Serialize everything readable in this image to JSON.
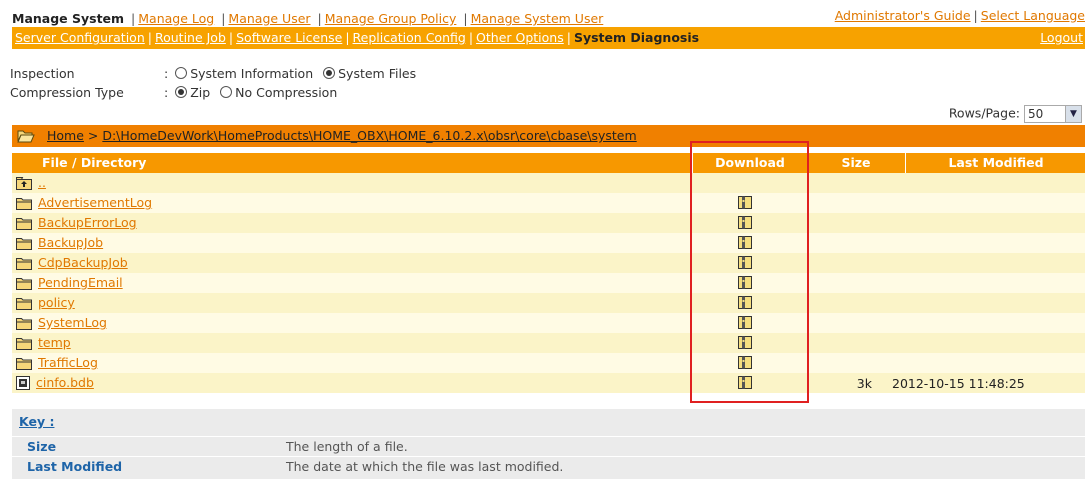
{
  "nav": {
    "title": "Manage System",
    "links": [
      "Manage Log",
      "Manage User",
      "Manage Group Policy",
      "Manage System User"
    ],
    "guide": "Administrator's Guide",
    "language": "Select Language"
  },
  "subnav": {
    "links": [
      "Server Configuration",
      "Routine Job",
      "Software License",
      "Replication Config",
      "Other Options"
    ],
    "active": "System Diagnosis",
    "logout": "Logout"
  },
  "options": {
    "inspection_label": "Inspection",
    "inspection_choices": [
      "System Information",
      "System Files"
    ],
    "inspection_selected": "System Files",
    "compression_label": "Compression Type",
    "compression_choices": [
      "Zip",
      "No Compression"
    ],
    "compression_selected": "Zip"
  },
  "rows_per_page": {
    "label": "Rows/Page:",
    "value": "50"
  },
  "path": {
    "home": "Home",
    "separator": " > ",
    "current": "D:\\HomeDevWork\\HomeProducts\\HOME_OBX\\HOME_6.10.2.x\\obsr\\core\\cbase\\system"
  },
  "table": {
    "headers": [
      "File / Directory",
      "Download",
      "Size",
      "Last Modified"
    ],
    "parent": "..",
    "rows": [
      {
        "name": "AdvertisementLog",
        "type": "folder",
        "size": "",
        "modified": ""
      },
      {
        "name": "BackupErrorLog",
        "type": "folder",
        "size": "",
        "modified": ""
      },
      {
        "name": "BackupJob",
        "type": "folder",
        "size": "",
        "modified": ""
      },
      {
        "name": "CdpBackupJob",
        "type": "folder",
        "size": "",
        "modified": ""
      },
      {
        "name": "PendingEmail",
        "type": "folder",
        "size": "",
        "modified": ""
      },
      {
        "name": "policy",
        "type": "folder",
        "size": "",
        "modified": ""
      },
      {
        "name": "SystemLog",
        "type": "folder",
        "size": "",
        "modified": ""
      },
      {
        "name": "temp",
        "type": "folder",
        "size": "",
        "modified": ""
      },
      {
        "name": "TrafficLog",
        "type": "folder",
        "size": "",
        "modified": ""
      },
      {
        "name": "cinfo.bdb",
        "type": "file",
        "size": "3k",
        "modified": "2012-10-15 11:48:25"
      }
    ]
  },
  "key": {
    "title": "Key :",
    "entries": [
      {
        "term": "Size",
        "desc": "The length of a file."
      },
      {
        "term": "Last Modified",
        "desc": "The date at which the file was last modified."
      }
    ]
  },
  "colors": {
    "accent": "#f7a200",
    "path_bar": "#f08000",
    "row_odd": "#fbf4c8",
    "row_even": "#fffbe4",
    "highlight": "#e02020"
  }
}
